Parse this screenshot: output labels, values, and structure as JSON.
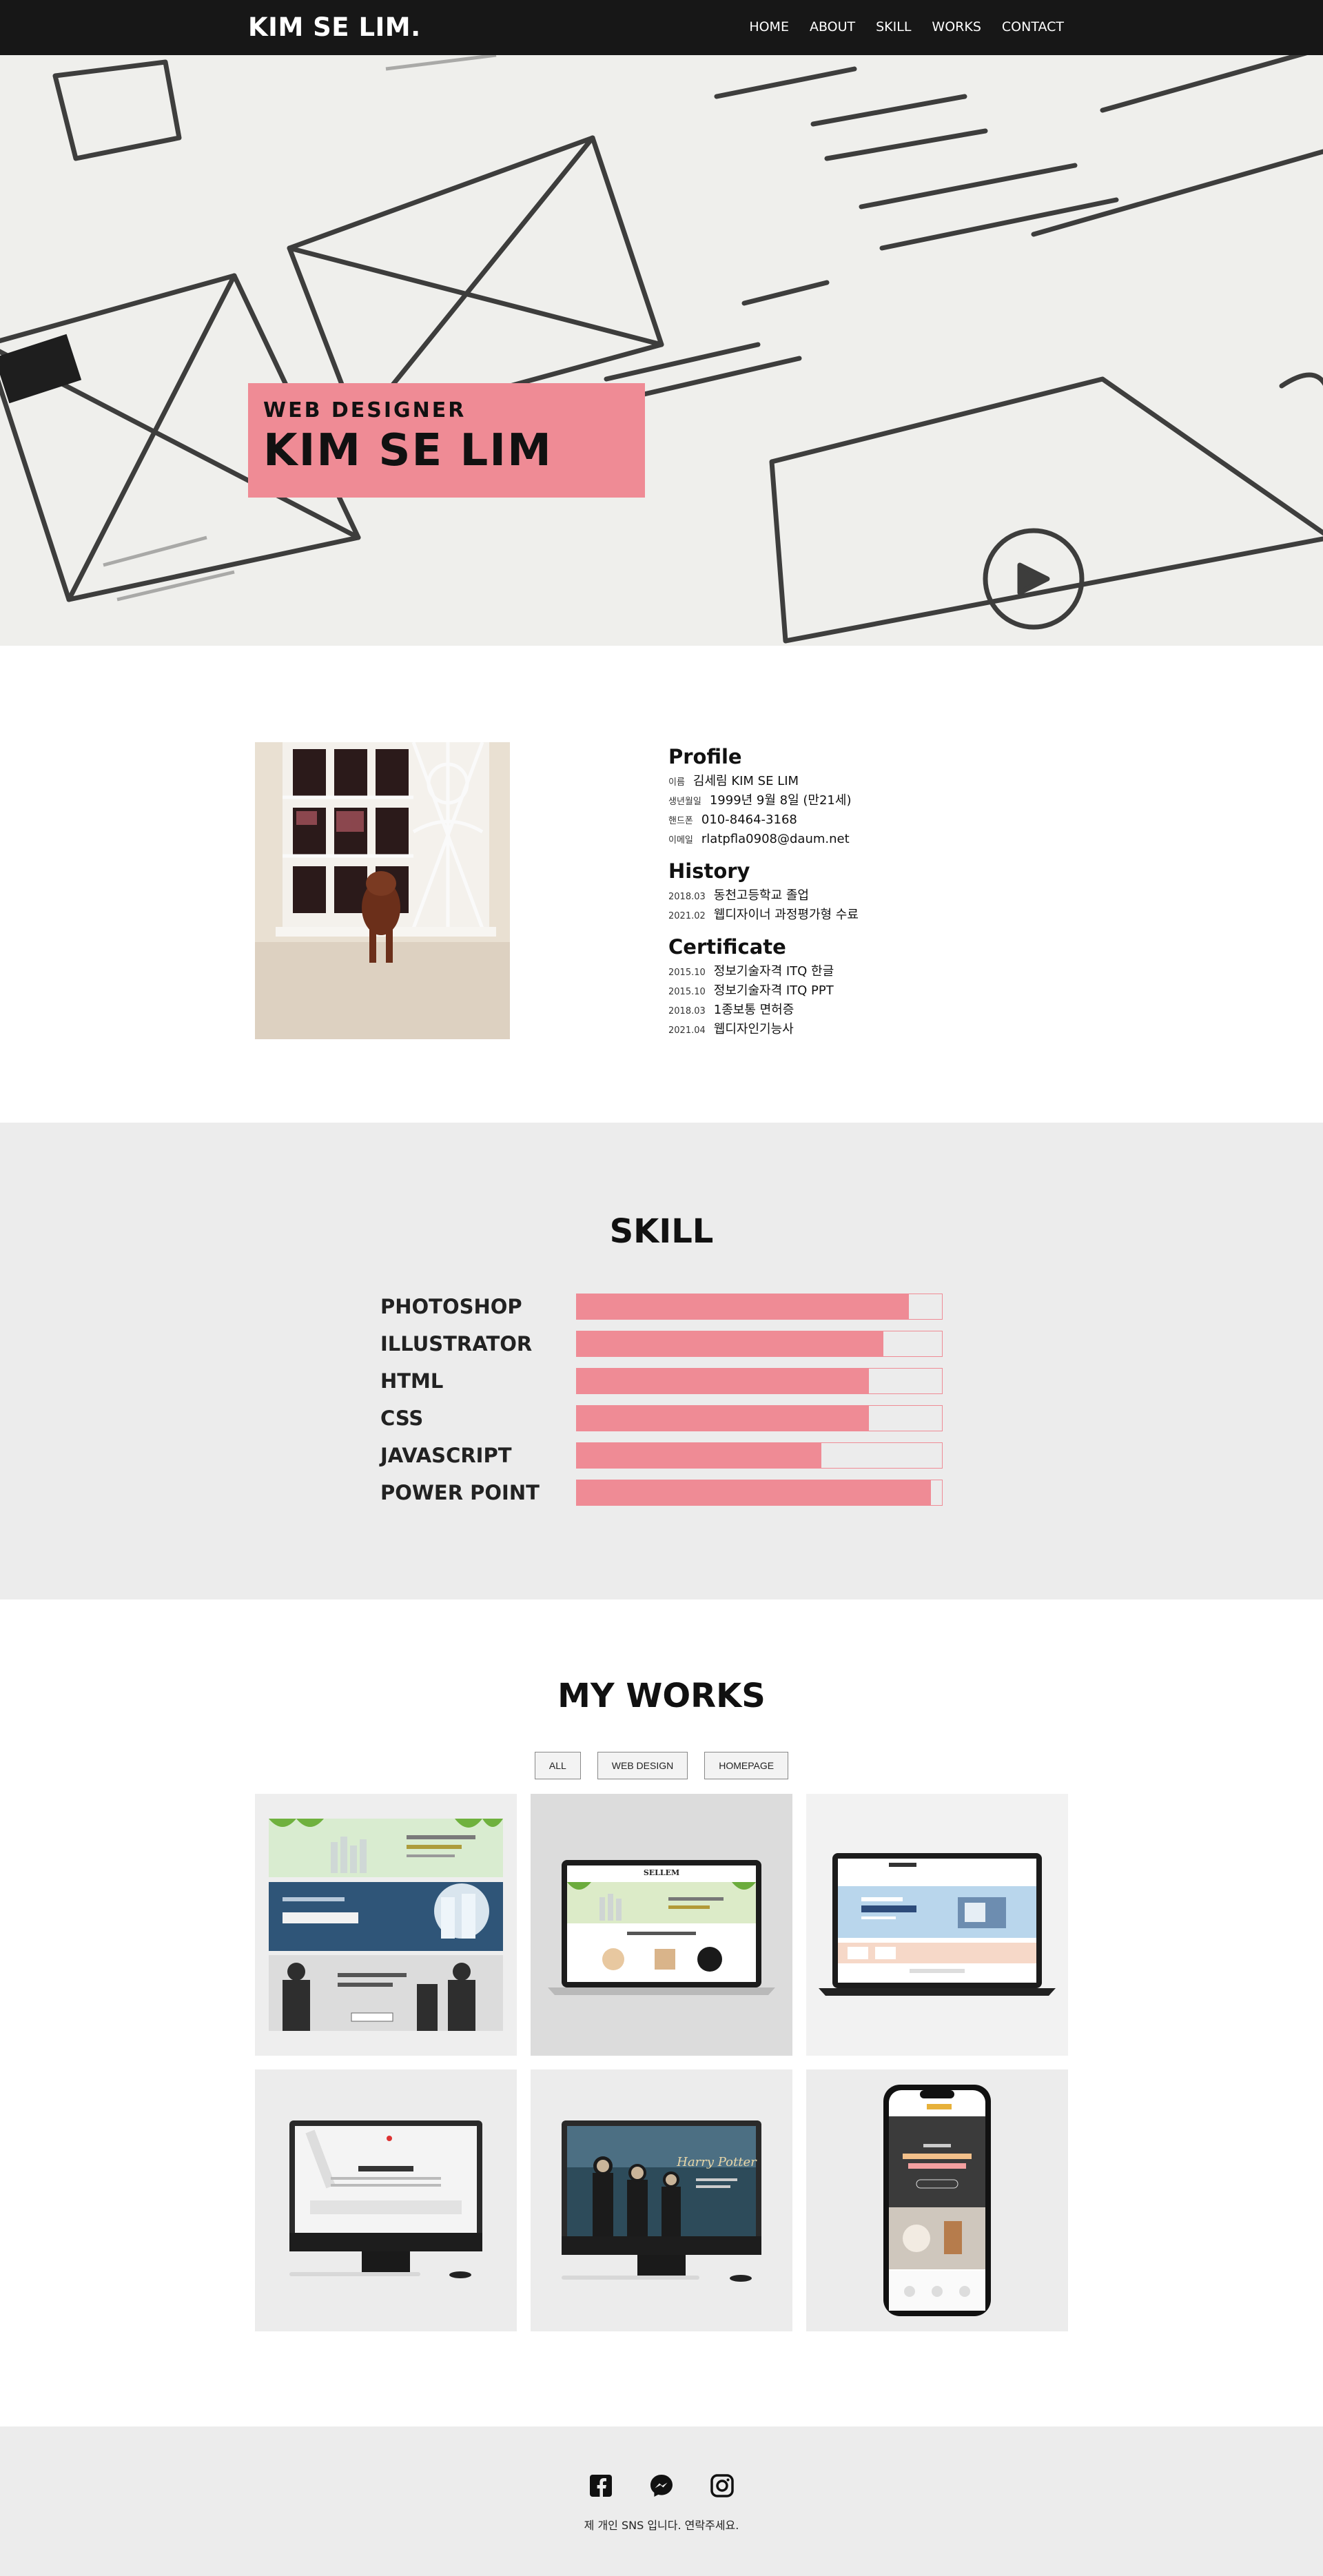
{
  "header": {
    "logo": "KIM SE LIM.",
    "menu": [
      "HOME",
      "ABOUT",
      "SKILL",
      "WORKS",
      "CONTACT"
    ]
  },
  "hero": {
    "subtitle": "WEB DESIGNER",
    "title": "KIM SE LIM"
  },
  "profile": {
    "profile_heading": "Profile",
    "profile_rows": [
      {
        "key": "이름",
        "value": "김세림 KIM SE LIM"
      },
      {
        "key": "생년월일",
        "value": "1999년 9월 8일 (만21세)"
      },
      {
        "key": "핸드폰",
        "value": "010-8464-3168"
      },
      {
        "key": "이메일",
        "value": "rlatpfla0908@daum.net"
      }
    ],
    "history_heading": "History",
    "history_rows": [
      {
        "key": "2018.03",
        "value": "동천고등학교 졸업"
      },
      {
        "key": "2021.02",
        "value": "웹디자이너 과정평가형 수료"
      }
    ],
    "certificate_heading": "Certificate",
    "certificate_rows": [
      {
        "key": "2015.10",
        "value": "정보기술자격 ITQ 한글"
      },
      {
        "key": "2015.10",
        "value": "정보기술자격 ITQ PPT"
      },
      {
        "key": "2018.03",
        "value": "1종보통 면허증"
      },
      {
        "key": "2021.04",
        "value": "웹디자인기능사"
      }
    ]
  },
  "skill": {
    "heading": "SKILL",
    "items": [
      {
        "name": "PHOTOSHOP",
        "level": 0.91
      },
      {
        "name": "ILLUSTRATOR",
        "level": 0.84
      },
      {
        "name": "HTML",
        "level": 0.8
      },
      {
        "name": "CSS",
        "level": 0.8
      },
      {
        "name": "JAVASCRIPT",
        "level": 0.67
      },
      {
        "name": "POWER POINT",
        "level": 0.97
      }
    ]
  },
  "works": {
    "heading": "MY WORKS",
    "filters": [
      "ALL",
      "WEB DESIGN",
      "HOMEPAGE"
    ],
    "items": [
      {
        "name": "banner-design-work"
      },
      {
        "name": "sellem-laptop-work"
      },
      {
        "name": "sellim-laptop-work"
      },
      {
        "name": "imac-site-work"
      },
      {
        "name": "harry-potter-imac-work"
      },
      {
        "name": "cafe-mobile-work"
      }
    ],
    "thumb_texts": {
      "sellem": "SELLEM",
      "harry": "Harry Potter"
    }
  },
  "footer": {
    "icons": [
      "facebook-icon",
      "messenger-icon",
      "instagram-icon"
    ],
    "text": "제 개인 SNS 입니다. 연락주세요."
  },
  "colors": {
    "accent": "#ef8b95",
    "nav": "#171717",
    "section_gray": "#ececec"
  }
}
